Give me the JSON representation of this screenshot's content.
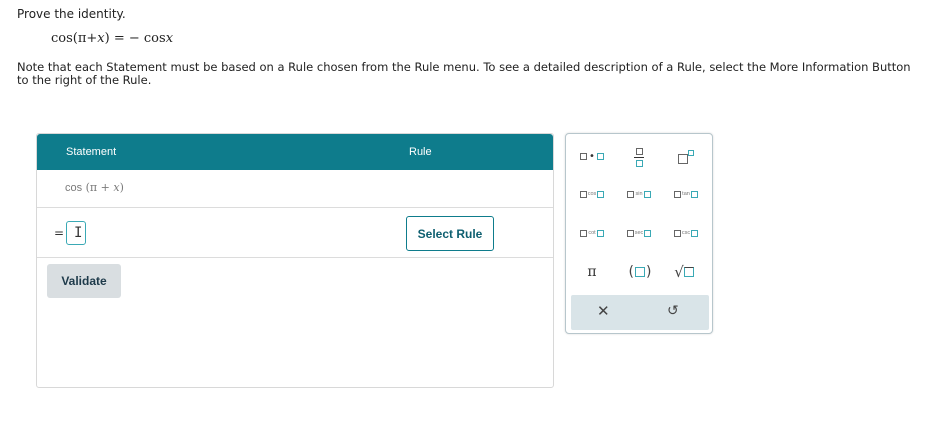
{
  "problem": {
    "prompt": "Prove the identity.",
    "identity": {
      "lhs_fn": "cos",
      "lhs_open": "(π+",
      "lhs_var": "x",
      "lhs_close": ") = − cos",
      "rhs_var": "x"
    },
    "note": "Note that each Statement must be based on a Rule chosen from the Rule menu. To see a detailed description of a Rule, select the More Information Button to the right of the Rule."
  },
  "table": {
    "header_statement": "Statement",
    "header_rule": "Rule",
    "row1": {
      "fn": "cos",
      "open": " (π + ",
      "var": "x",
      "close": ")"
    },
    "row2": {
      "eq": "=",
      "cursor": "I",
      "select_rule_label": "Select Rule"
    },
    "validate_label": "Validate"
  },
  "palette": {
    "dot": "•",
    "cos": "cos",
    "sin": "sin",
    "tan": "tan",
    "cot": "cot",
    "sec": "sec",
    "csc": "csc",
    "pi": "π",
    "paren_open": "(",
    "paren_close": ")",
    "sqrt": "√",
    "clear": "✕",
    "undo": "↺"
  },
  "colors": {
    "accent": "#0e7c8c",
    "input_border": "#3aa9b5",
    "button_bg": "#d9dee1",
    "palette_footer": "#d9e4e8"
  }
}
